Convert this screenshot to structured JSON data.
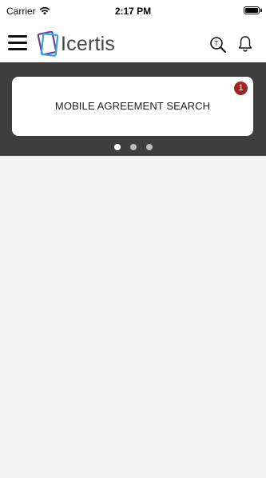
{
  "status_bar": {
    "carrier": "Carrier",
    "time": "2:17 PM"
  },
  "header": {
    "logo_text": "Icertis",
    "search_icon_letter": "T"
  },
  "carousel": {
    "card_title": "MOBILE AGREEMENT SEARCH",
    "badge_count": "1",
    "page_count": 3,
    "active_page": 1
  },
  "colors": {
    "brand_purple": "#6b3fa0",
    "brand_blue": "#3aa3d9",
    "badge_red": "#a32323",
    "carousel_bg": "#3e3e3e"
  }
}
